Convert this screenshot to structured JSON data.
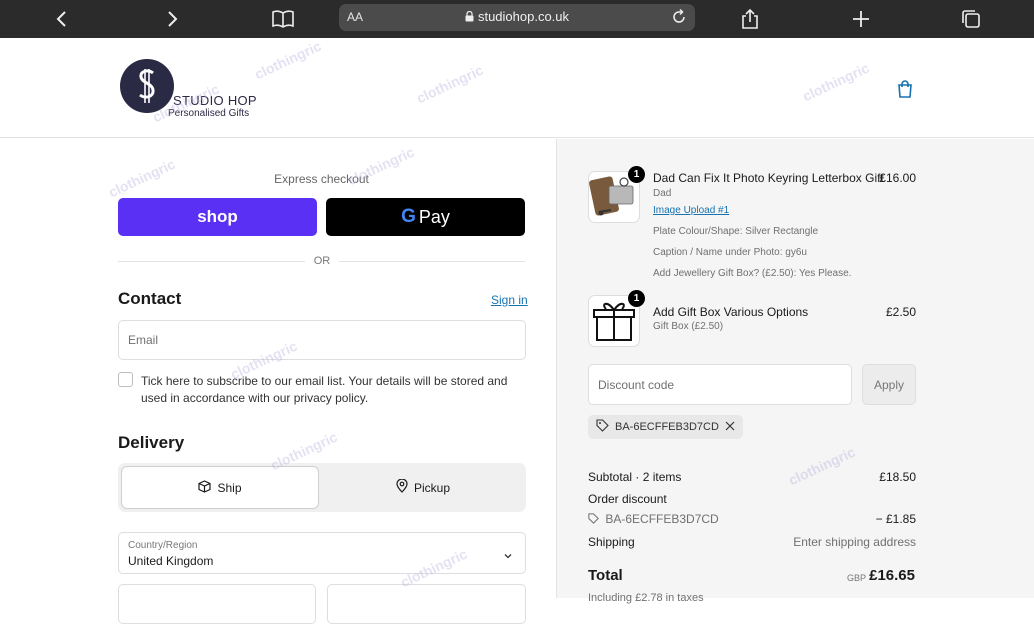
{
  "browser": {
    "aa_label": "AA",
    "url": "studiohop.co.uk"
  },
  "brand": {
    "name_line1": "STUDIO HOP",
    "name_line2": "Personalised Gifts"
  },
  "express": {
    "label": "Express checkout",
    "shop_label": "shop",
    "gpay_g": "G",
    "gpay_label": "Pay",
    "or_label": "OR"
  },
  "contact": {
    "heading": "Contact",
    "signin_label": "Sign in",
    "email_placeholder": "Email",
    "subscribe_text": "Tick here to subscribe to our email list. Your details will be stored and used in accordance with our privacy policy."
  },
  "delivery": {
    "heading": "Delivery",
    "ship_label": "Ship",
    "pickup_label": "Pickup",
    "country_label": "Country/Region",
    "country_value": "United Kingdom"
  },
  "cart": {
    "items": [
      {
        "qty": "1",
        "title": "Dad Can Fix It Photo Keyring Letterbox Gift",
        "variant": "Dad",
        "link": "Image Upload #1",
        "prop1": "Plate Colour/Shape: Silver Rectangle",
        "prop2": "Caption / Name under Photo: gy6u",
        "prop3": "Add Jewellery Gift Box? (£2.50): Yes Please.",
        "price": "£16.00"
      },
      {
        "qty": "1",
        "title": "Add Gift Box Various Options",
        "variant": "Gift Box (£2.50)",
        "price": "£2.50"
      }
    ]
  },
  "discount": {
    "placeholder": "Discount code",
    "apply_label": "Apply",
    "applied_code": "BA-6ECFFEB3D7CD"
  },
  "summary": {
    "subtotal_label": "Subtotal · 2 items",
    "subtotal_value": "£18.50",
    "order_discount_label": "Order discount",
    "discount_code": "BA-6ECFFEB3D7CD",
    "discount_value": "− £1.85",
    "shipping_label": "Shipping",
    "shipping_value": "Enter shipping address",
    "total_label": "Total",
    "currency": "GBP",
    "total_value": "£16.65",
    "taxes_text": "Including £2.78 in taxes"
  },
  "watermark": "clothingric"
}
